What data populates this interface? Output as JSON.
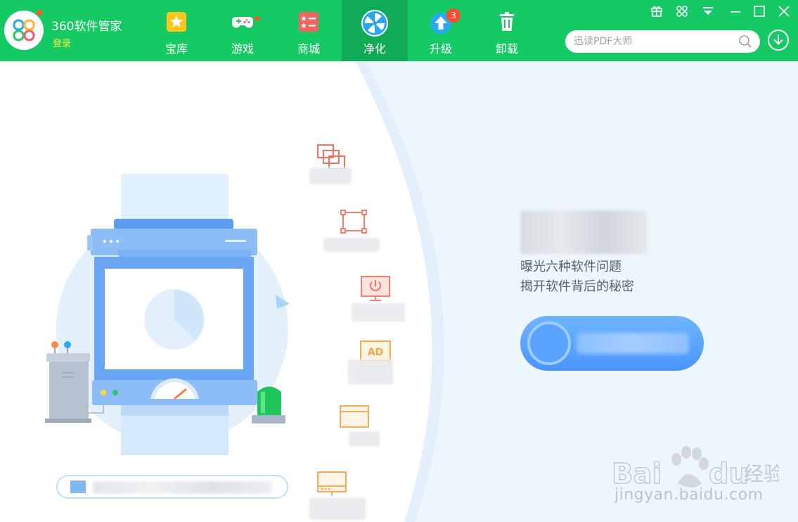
{
  "app": {
    "title": "360软件管家",
    "login_label": "登录"
  },
  "nav": {
    "tabs": [
      {
        "label": "宝库",
        "icon": "star-icon"
      },
      {
        "label": "游戏",
        "icon": "gamepad-icon"
      },
      {
        "label": "商城",
        "icon": "shop-icon"
      },
      {
        "label": "净化",
        "icon": "purify-fan-icon",
        "active": true
      },
      {
        "label": "升级",
        "icon": "upgrade-arrow-icon",
        "badge": "3"
      },
      {
        "label": "卸载",
        "icon": "trash-icon"
      }
    ]
  },
  "search": {
    "placeholder": "迅读PDF大师"
  },
  "main": {
    "description_line1": "曝光六种软件问题",
    "description_line2": "揭开软件背后的秘密"
  },
  "watermark": {
    "text": "jingyan.baidu.com"
  },
  "colors": {
    "topbar": "#15c964",
    "topbar_active": "#10ab56",
    "primary_button": "#4a94ff",
    "badge": "#ff4a2b",
    "login": "#ffee35"
  }
}
